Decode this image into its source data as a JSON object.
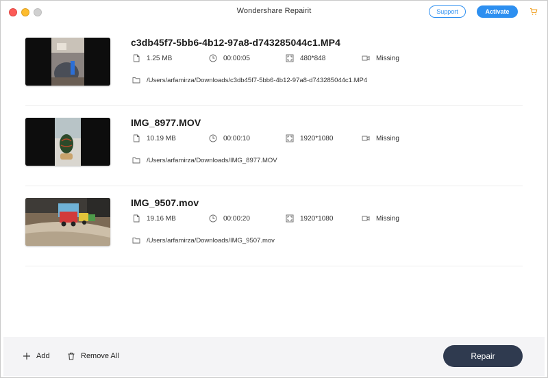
{
  "window": {
    "title": "Wondershare Repairit",
    "support_label": "Support",
    "activate_label": "Activate"
  },
  "files": [
    {
      "name": "c3db45f7-5bb6-4b12-97a8-d743285044c1.MP4",
      "size": "1.25 MB",
      "duration": "00:00:05",
      "resolution": "480*848",
      "status": "Missing",
      "path": "/Users/arfamirza/Downloads/c3db45f7-5bb6-4b12-97a8-d743285044c1.MP4"
    },
    {
      "name": "IMG_8977.MOV",
      "size": "10.19 MB",
      "duration": "00:00:10",
      "resolution": "1920*1080",
      "status": "Missing",
      "path": "/Users/arfamirza/Downloads/IMG_8977.MOV"
    },
    {
      "name": "IMG_9507.mov",
      "size": "19.16 MB",
      "duration": "00:00:20",
      "resolution": "1920*1080",
      "status": "Missing",
      "path": "/Users/arfamirza/Downloads/IMG_9507.mov"
    }
  ],
  "footer": {
    "add_label": "Add",
    "remove_all_label": "Remove All",
    "repair_label": "Repair"
  },
  "colors": {
    "accent": "#2d8ff0",
    "repair_button": "#2f3a4f",
    "footer_bg": "#f4f4f6"
  }
}
